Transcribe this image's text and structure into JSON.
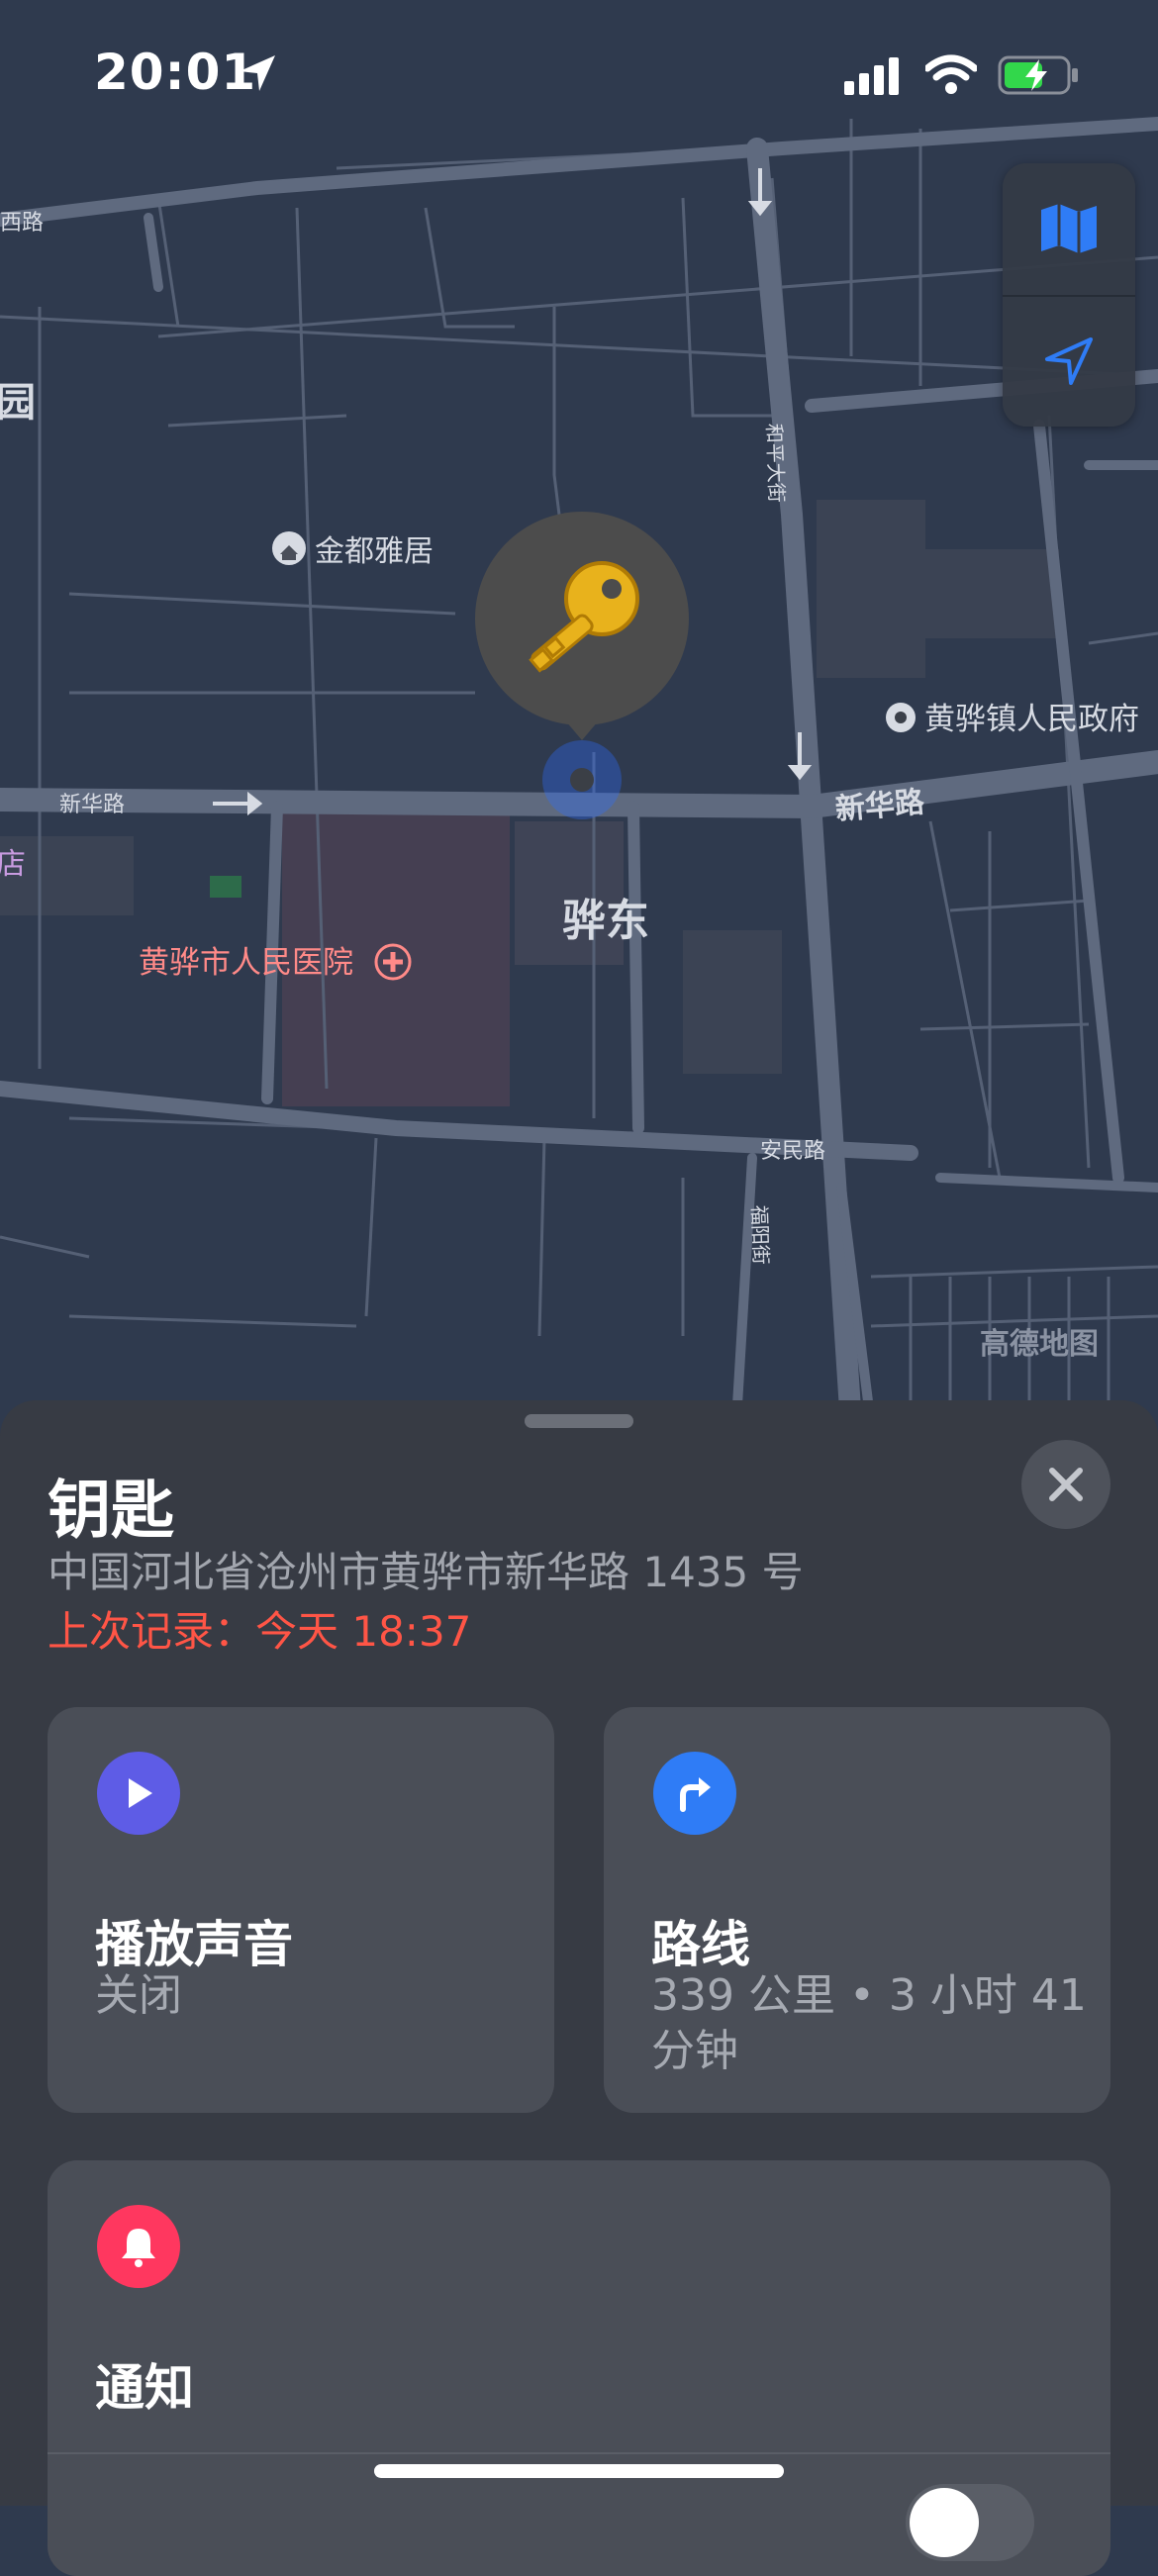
{
  "status_bar": {
    "time": "20:01"
  },
  "map": {
    "labels": {
      "road_west_top": "西路",
      "park_edge": "园",
      "jindu_yaju": "金都雅居",
      "heping_dajie": "和平大街",
      "town_gov": "黄骅镇人民政府",
      "xinhua_road_left": "新华路",
      "xinhua_road_right": "新华路",
      "shop_edge": "店",
      "hospital": "黄骅市人民医院",
      "district": "骅东",
      "anmin_road": "安民路",
      "fuyang_street": "福阳街",
      "watermark": "高德地图"
    },
    "controls": [
      "map-icon",
      "location-arrow-icon"
    ]
  },
  "item": {
    "title": "钥匙",
    "address": "中国河北省沧州市黄骅市新华路 1435 号",
    "last_seen": "上次记录：今天 18:37"
  },
  "actions": {
    "play_sound": {
      "title": "播放声音",
      "subtitle": "关闭",
      "icon": "play-icon",
      "color": "#5e5ce6"
    },
    "directions": {
      "title": "路线",
      "subtitle": "339 公里 • 3 小时 41 分钟",
      "icon": "turn-right-arrow-icon",
      "color": "#2f7cf6"
    },
    "notifications": {
      "title": "通知",
      "icon": "bell-icon",
      "color": "#ff375f"
    }
  }
}
